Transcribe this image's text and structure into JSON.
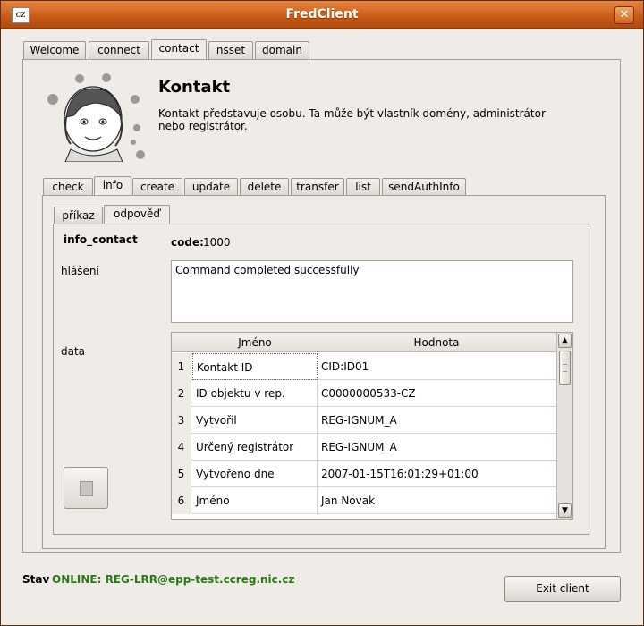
{
  "window": {
    "title": "FredClient",
    "icon_text": "cz",
    "close_glyph": "✕"
  },
  "main_tabs": [
    {
      "label": "Welcome"
    },
    {
      "label": "connect"
    },
    {
      "label": "contact"
    },
    {
      "label": "nsset"
    },
    {
      "label": "domain"
    }
  ],
  "section": {
    "heading": "Kontakt",
    "description": " Kontakt představuje osobu. Ta může být vlastník domény, administrátor nebo registrátor."
  },
  "command_tabs": [
    {
      "label": "check"
    },
    {
      "label": "info"
    },
    {
      "label": "create"
    },
    {
      "label": "update"
    },
    {
      "label": "delete"
    },
    {
      "label": "transfer"
    },
    {
      "label": "list"
    },
    {
      "label": "sendAuthInfo"
    }
  ],
  "sub_tabs": [
    {
      "label": "příkaz"
    },
    {
      "label": "odpověď"
    }
  ],
  "response": {
    "command_name": "info_contact",
    "code_label": "code:",
    "code_value": "1000",
    "message_label": "hlášení",
    "message": "Command completed successfully",
    "data_label": "data"
  },
  "table": {
    "columns": [
      "Jméno",
      "Hodnota"
    ],
    "rows": [
      {
        "num": "1",
        "name": "Kontakt ID",
        "value": "CID:ID01"
      },
      {
        "num": "2",
        "name": "ID objektu v rep.",
        "value": "C0000000533-CZ"
      },
      {
        "num": "3",
        "name": "Vytvořil",
        "value": "REG-IGNUM_A"
      },
      {
        "num": "4",
        "name": "Určený registrátor",
        "value": "REG-IGNUM_A"
      },
      {
        "num": "5",
        "name": "Vytvořeno dne",
        "value": "2007-01-15T16:01:29+01:00"
      },
      {
        "num": "6",
        "name": "Jméno",
        "value": "Jan Novak"
      }
    ]
  },
  "status": {
    "label": "Stav",
    "value": "ONLINE: REG-LRR@epp-test.ccreg.nic.cz"
  },
  "exit_button": {
    "label": "Exit client"
  }
}
